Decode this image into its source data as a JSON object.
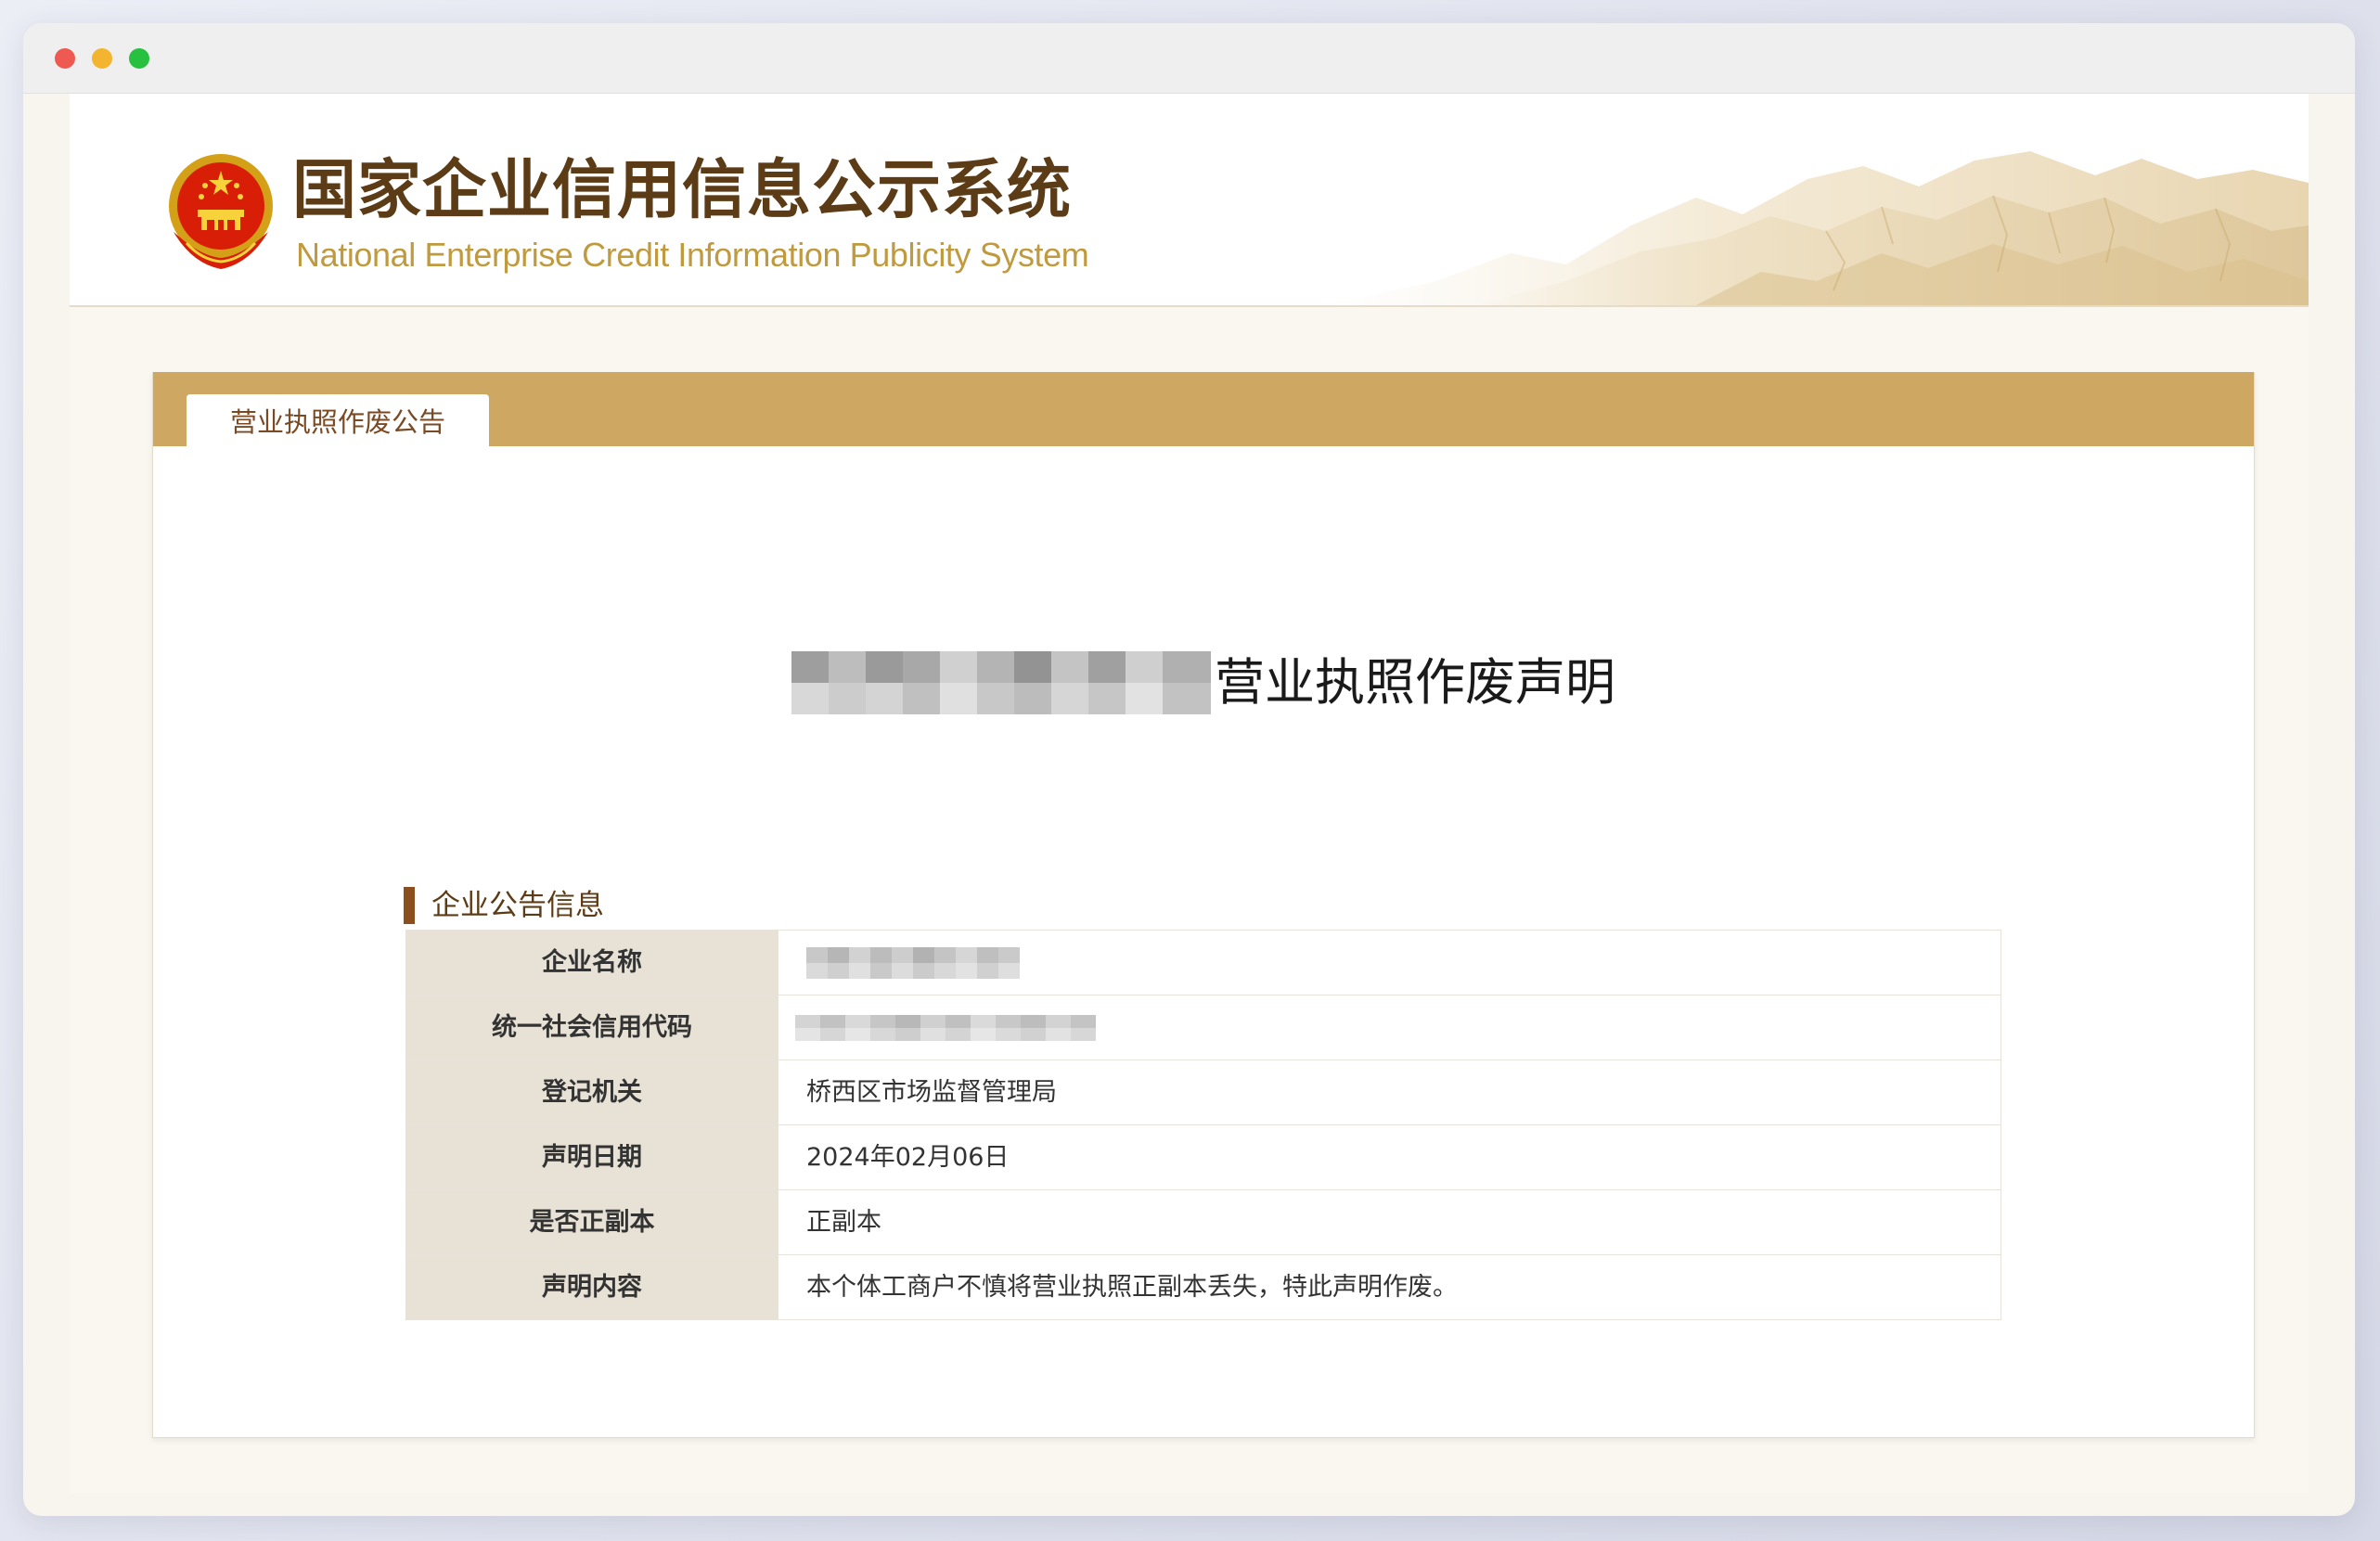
{
  "site": {
    "title_cn": "国家企业信用信息公示系统",
    "title_en": "National Enterprise Credit Information Publicity System"
  },
  "tab": {
    "label": "营业执照作废公告"
  },
  "announcement": {
    "title_suffix": "营业执照作废声明"
  },
  "section": {
    "title": "企业公告信息"
  },
  "info_rows": [
    {
      "key": "企业名称",
      "value": ""
    },
    {
      "key": "统一社会信用代码",
      "value": ""
    },
    {
      "key": "登记机关",
      "value": "桥西区市场监督管理局"
    },
    {
      "key": "声明日期",
      "value": "2024年02月06日"
    },
    {
      "key": "是否正副本",
      "value": "正副本"
    },
    {
      "key": "声明内容",
      "value": "本个体工商户不慎将营业执照正副本丢失，特此声明作废。"
    }
  ],
  "icons": {
    "emblem": "national-emblem-icon",
    "scenery": "mountain-scenery-icon"
  },
  "colors": {
    "brand_brown": "#5c3c16",
    "brand_gold": "#bf9a3e",
    "tab_bar": "#cea862",
    "label_cell": "#e8e2d6"
  }
}
